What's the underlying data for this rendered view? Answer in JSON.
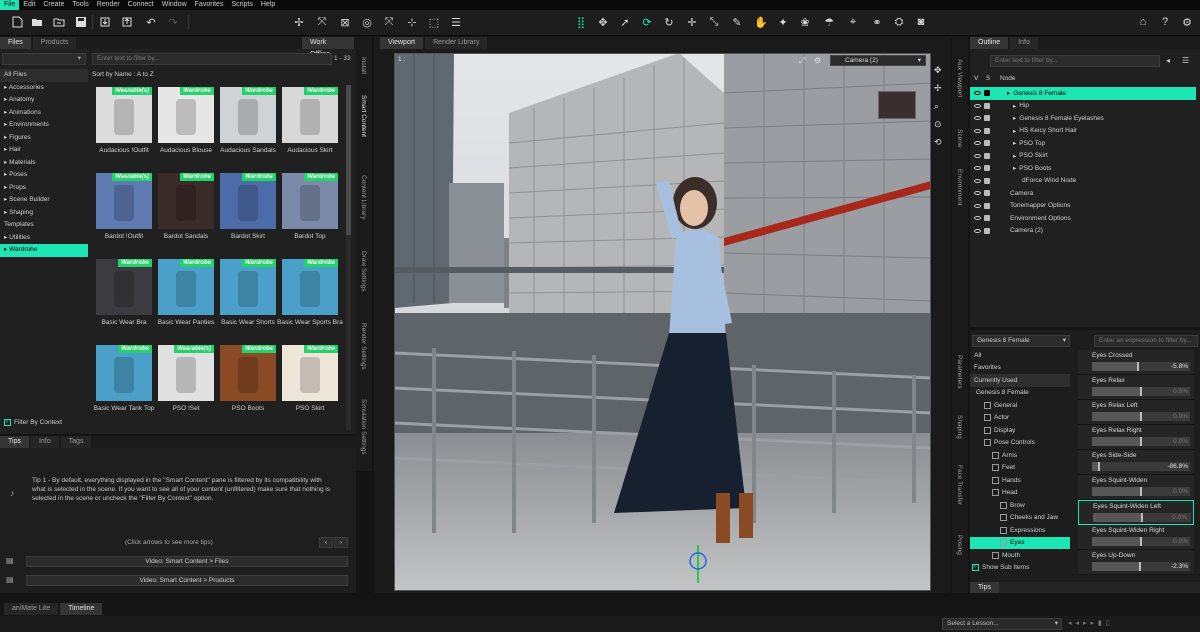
{
  "menu": [
    "File",
    "Edit",
    "Create",
    "Tools",
    "Render",
    "Connect",
    "Window",
    "Favorites",
    "Scripts",
    "Help"
  ],
  "colors": {
    "accent": "#1ce6b4",
    "badge": "#22d36a"
  },
  "toolbar_icons": [
    "new-file-icon",
    "open-folder-icon",
    "merge-folder-icon",
    "save-icon",
    "import-icon",
    "export-icon",
    "undo-icon",
    "redo-icon",
    "node-tool-icon",
    "universal-tool-icon",
    "pointer-icon",
    "rotate-tool-icon",
    "translate-tool-icon",
    "scale-tool-icon",
    "joint-editor-icon",
    "figure-pose-icon",
    "home-icon",
    "help-icon",
    "settings-icon"
  ],
  "left": {
    "tabs": [
      "Files",
      "Products"
    ],
    "work_offline": "Work Offline",
    "filter_placeholder": "Enter text to filter by...",
    "page_range": "1 - 33",
    "sort_label": "Sort by Name : A to Z",
    "categories": [
      "All Files",
      "Accessories",
      "Anatomy",
      "Animations",
      "Environments",
      "Figures",
      "Hair",
      "Materials",
      "Poses",
      "Props",
      "Scene Builder",
      "Shaping",
      "Templates",
      "Utilities",
      "Wardrobe"
    ],
    "filter_by_context": "Filter By Context",
    "products": [
      {
        "name": "Audacious !Outfit",
        "badge": "Wearable(s)"
      },
      {
        "name": "Audacious Blouse",
        "badge": "Wardrobe"
      },
      {
        "name": "Audacious Sandals",
        "badge": "Wardrobe"
      },
      {
        "name": "Audacious Skirt",
        "badge": "Wardrobe"
      },
      {
        "name": "Bardot !Outfit",
        "badge": "Wearable(s)"
      },
      {
        "name": "Bardot Sandals",
        "badge": "Wardrobe"
      },
      {
        "name": "Bardot Skirt",
        "badge": "Wardrobe"
      },
      {
        "name": "Bardot Top",
        "badge": "Wardrobe"
      },
      {
        "name": "Basic Wear Bra",
        "badge": "Wardrobe"
      },
      {
        "name": "Basic Wear Panties",
        "badge": "Wardrobe"
      },
      {
        "name": "Basic Wear Shorts",
        "badge": "Wardrobe"
      },
      {
        "name": "Basic Wear Sports Bra",
        "badge": "Wardrobe"
      },
      {
        "name": "Basic Wear Tank Top",
        "badge": "Wardrobe"
      },
      {
        "name": "PSO !Set",
        "badge": "Wearable(s)"
      },
      {
        "name": "PSO Boots",
        "badge": "Wardrobe"
      },
      {
        "name": "PSO Skirt",
        "badge": "Wardrobe"
      }
    ],
    "side_tabs": [
      "Install",
      "Smart Content",
      "Content Library",
      "Draw Settings",
      "Render Settings",
      "Simulation Settings"
    ]
  },
  "tips": {
    "tabs": [
      "Tips",
      "Info",
      "Tags"
    ],
    "text": "Tip 1 - By default, everything displayed in the \"Smart Content\" pane is filtered by its compatibility with what is selected in the scene. If you want to see all of your content (unfiltered) make sure that nothing is selected in the scene or uncheck the \"Filter By Context\" option.",
    "nav_hint": "(Click arrows to see more tips)",
    "video1": "Video: Smart Content > Files",
    "video2": "Video: Smart Content > Products"
  },
  "viewport": {
    "tabs": [
      "Viewport",
      "Render Library"
    ],
    "camera": "Camera (2)",
    "corner_label": "1 :"
  },
  "scene": {
    "tabs": [
      "Outline",
      "Info"
    ],
    "filter_placeholder": "Enter text to filter by...",
    "col_v": "V",
    "col_s": "S",
    "col_node": "Node",
    "nodes": [
      "Genesis 8 Female",
      "Hip",
      "Genesis 8 Female Eyelashes",
      "HS Keicy Short Hair",
      "PSO Top",
      "PSO Skirt",
      "PSO Boots",
      "dForce Wind Node",
      "Camera",
      "Tonemapper Options",
      "Environment Options",
      "Camera (2)"
    ],
    "side_tabs": [
      "Aux Viewport",
      "Scene",
      "Environment"
    ]
  },
  "params": {
    "figure": "Genesis 8 Female",
    "filter_placeholder": "Enter an expression to filter by...",
    "tree": [
      "All",
      "Favorites",
      "Currently Used",
      "Genesis 8 Female",
      "General",
      "Actor",
      "Display",
      "Pose Controls",
      "Arms",
      "Feet",
      "Hands",
      "Head",
      "Brow",
      "Cheeks and Jaw",
      "Expressions",
      "Eyes",
      "Mouth"
    ],
    "show_sub_items": "Show Sub Items",
    "tips_tab": "Tips",
    "side_tabs": [
      "Parameters",
      "Shaping",
      "Face Transfer",
      "Posing"
    ],
    "rows": [
      {
        "name": "Eyes Crossed",
        "value": "-5.8%",
        "level": 0.47,
        "bright": true,
        "sel": false
      },
      {
        "name": "Eyes Relax",
        "value": "0.0%",
        "level": 0.5,
        "bright": false,
        "sel": false
      },
      {
        "name": "Eyes Relax Left",
        "value": "0.0%",
        "level": 0.5,
        "bright": false,
        "sel": false
      },
      {
        "name": "Eyes Relax Right",
        "value": "0.0%",
        "level": 0.5,
        "bright": false,
        "sel": false
      },
      {
        "name": "Eyes Side-Side",
        "value": "-86.8%",
        "level": 0.07,
        "bright": true,
        "sel": false
      },
      {
        "name": "Eyes Squint-Widen",
        "value": "0.0%",
        "level": 0.5,
        "bright": false,
        "sel": false
      },
      {
        "name": "Eyes Squint-Widen Left",
        "value": "0.0%",
        "level": 0.5,
        "bright": false,
        "sel": true
      },
      {
        "name": "Eyes Squint-Widen Right",
        "value": "0.0%",
        "level": 0.5,
        "bright": false,
        "sel": false
      },
      {
        "name": "Eyes Up-Down",
        "value": "-2.3%",
        "level": 0.49,
        "bright": true,
        "sel": false
      }
    ]
  },
  "bottom": {
    "tabs": [
      "aniMate Lite",
      "Timeline"
    ],
    "lesson_placeholder": "Select a Lesson..."
  }
}
